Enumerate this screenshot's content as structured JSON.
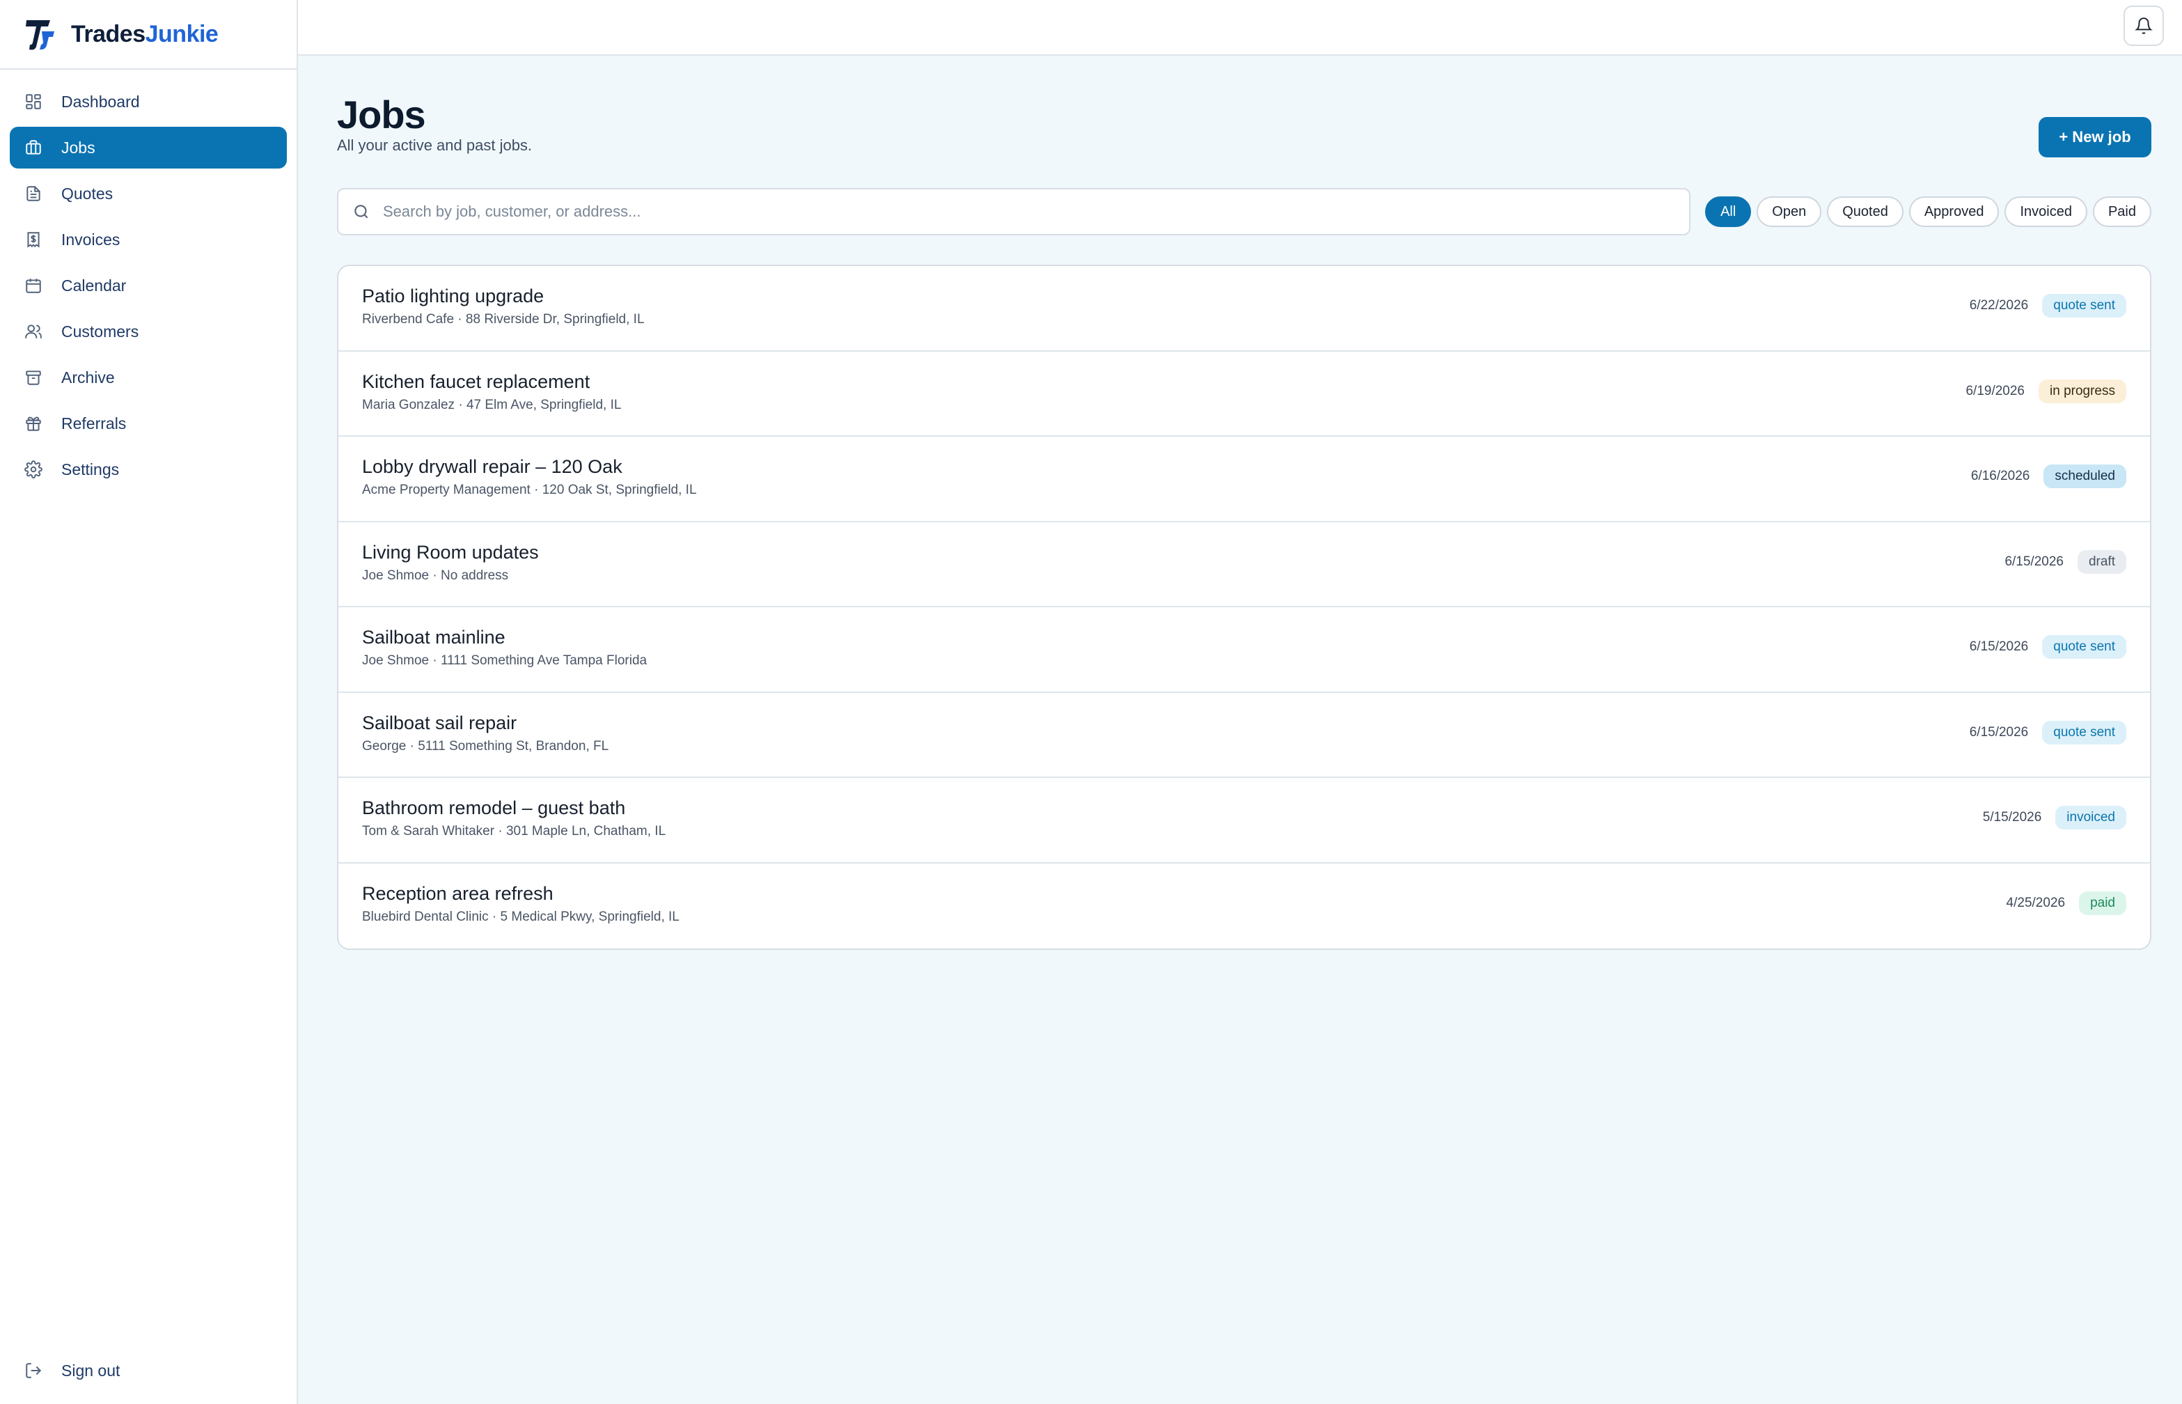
{
  "brand": {
    "part1": "Trades",
    "part2": "Junkie",
    "logo_text": "TJ"
  },
  "sidebar": {
    "items": [
      {
        "label": "Dashboard",
        "icon": "grid-icon",
        "active": false
      },
      {
        "label": "Jobs",
        "icon": "briefcase-icon",
        "active": true
      },
      {
        "label": "Quotes",
        "icon": "document-icon",
        "active": false
      },
      {
        "label": "Invoices",
        "icon": "receipt-icon",
        "active": false
      },
      {
        "label": "Calendar",
        "icon": "calendar-icon",
        "active": false
      },
      {
        "label": "Customers",
        "icon": "users-icon",
        "active": false
      },
      {
        "label": "Archive",
        "icon": "archive-icon",
        "active": false
      },
      {
        "label": "Referrals",
        "icon": "gift-icon",
        "active": false
      },
      {
        "label": "Settings",
        "icon": "gear-icon",
        "active": false
      }
    ],
    "signout_label": "Sign out"
  },
  "header": {
    "title": "Jobs",
    "subtitle": "All your active and past jobs.",
    "new_job_label": "+ New job"
  },
  "search": {
    "placeholder": "Search by job, customer, or address..."
  },
  "filters": [
    "All",
    "Open",
    "Quoted",
    "Approved",
    "Invoiced",
    "Paid"
  ],
  "active_filter": "All",
  "status_colors": {
    "quote sent": {
      "bg": "#dcf0fa",
      "fg": "#0b76ad"
    },
    "in progress": {
      "bg": "#fcefd8",
      "fg": "#3a2c10"
    },
    "scheduled": {
      "bg": "#c8e6f5",
      "fg": "#14304a"
    },
    "draft": {
      "bg": "#e9edf1",
      "fg": "#4a5565"
    },
    "invoiced": {
      "bg": "#dcf0fa",
      "fg": "#0b76ad"
    },
    "paid": {
      "bg": "#dcf5ea",
      "fg": "#1c8a5c"
    }
  },
  "jobs": [
    {
      "title": "Patio lighting upgrade",
      "meta": "Riverbend Cafe · 88 Riverside Dr, Springfield, IL",
      "date": "6/22/2026",
      "status": "quote sent"
    },
    {
      "title": "Kitchen faucet replacement",
      "meta": "Maria Gonzalez · 47 Elm Ave, Springfield, IL",
      "date": "6/19/2026",
      "status": "in progress"
    },
    {
      "title": "Lobby drywall repair – 120 Oak",
      "meta": "Acme Property Management · 120 Oak St, Springfield, IL",
      "date": "6/16/2026",
      "status": "scheduled"
    },
    {
      "title": "Living Room updates",
      "meta": "Joe Shmoe · No address",
      "date": "6/15/2026",
      "status": "draft"
    },
    {
      "title": "Sailboat mainline",
      "meta": "Joe Shmoe · 1111 Something Ave Tampa Florida",
      "date": "6/15/2026",
      "status": "quote sent"
    },
    {
      "title": "Sailboat sail repair",
      "meta": "George · 5111 Something St, Brandon, FL",
      "date": "6/15/2026",
      "status": "quote sent"
    },
    {
      "title": "Bathroom remodel – guest bath",
      "meta": "Tom & Sarah Whitaker · 301 Maple Ln, Chatham, IL",
      "date": "5/15/2026",
      "status": "invoiced"
    },
    {
      "title": "Reception area refresh",
      "meta": "Bluebird Dental Clinic · 5 Medical Pkwy, Springfield, IL",
      "date": "4/25/2026",
      "status": "paid"
    }
  ]
}
